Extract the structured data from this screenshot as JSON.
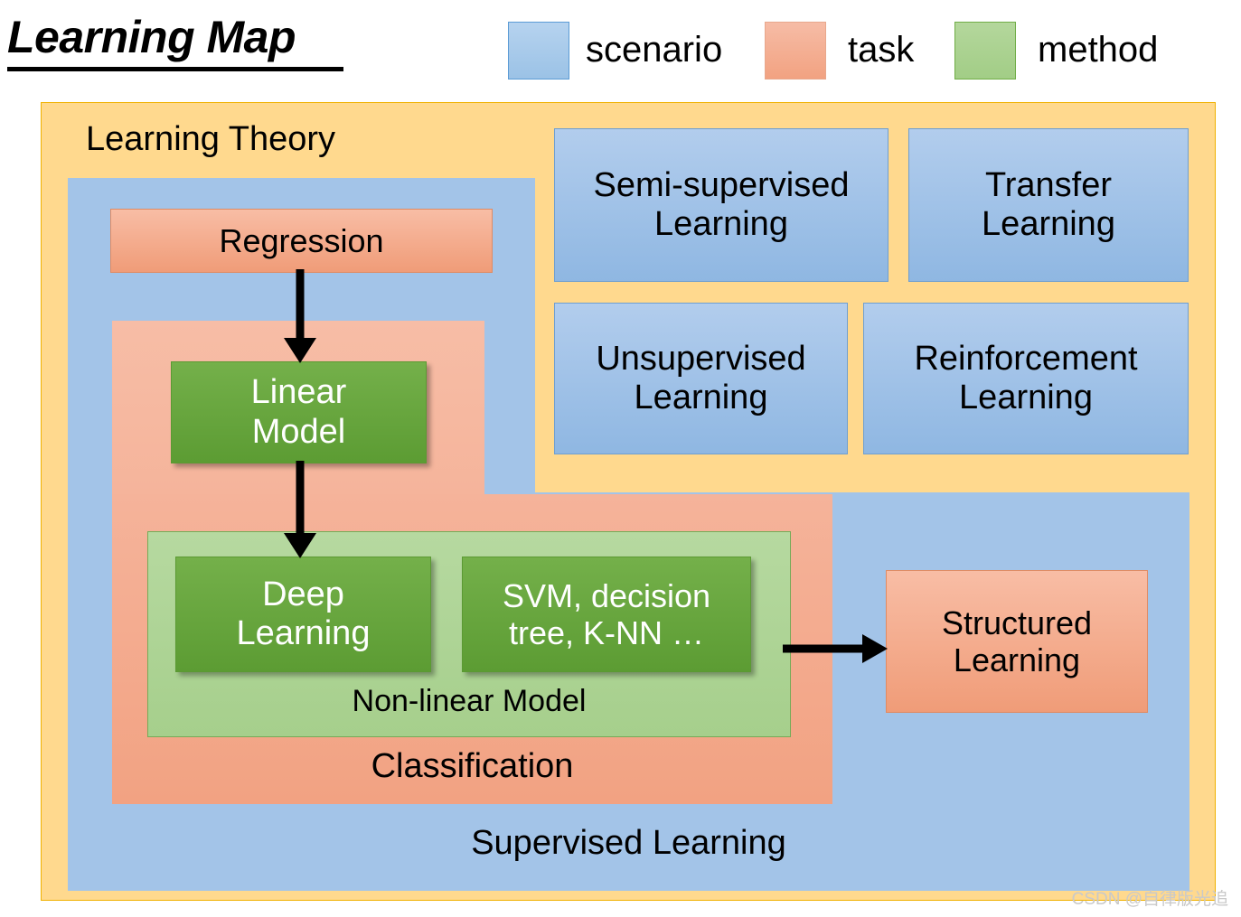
{
  "title": "Learning Map",
  "legend": {
    "items": [
      {
        "label": "scenario",
        "color": "#9bc2e6"
      },
      {
        "label": "task",
        "color": "#f2a281"
      },
      {
        "label": "method",
        "color": "#a2cd86"
      }
    ]
  },
  "containers": {
    "learning_theory": "Learning Theory",
    "supervised_learning": "Supervised Learning",
    "classification": "Classification",
    "non_linear_model": "Non-linear Model"
  },
  "nodes": {
    "regression": "Regression",
    "linear_model": "Linear\nModel",
    "deep_learning": "Deep\nLearning",
    "svm_etc": "SVM, decision\ntree, K-NN …",
    "structured_learning": "Structured\nLearning",
    "semi_supervised": "Semi-supervised\nLearning",
    "transfer": "Transfer\nLearning",
    "unsupervised": "Unsupervised\nLearning",
    "reinforcement": "Reinforcement\nLearning"
  },
  "arrows": [
    {
      "name": "regression-to-linear-model",
      "direction": "down"
    },
    {
      "name": "linear-model-to-deep-learning",
      "direction": "down"
    },
    {
      "name": "non-linear-to-structured-learning",
      "direction": "right"
    }
  ],
  "watermark": "CSDN @自律版光追",
  "colors": {
    "scenario": "#9bc2e6",
    "task": "#f2a281",
    "method": "#70ad47",
    "theory_bg": "#ffd98e",
    "arrow": "#000000"
  }
}
